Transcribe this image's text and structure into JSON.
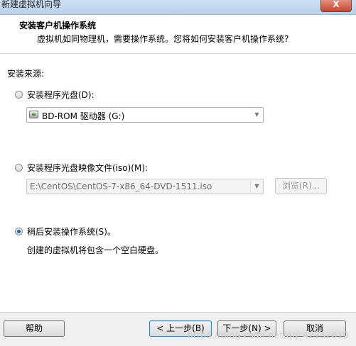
{
  "window": {
    "title": "新建虚拟机向导",
    "close_label": "X"
  },
  "header": {
    "title": "安装客户机操作系统",
    "subtitle": "虚拟机如同物理机，需要操作系统。您将如何安装客户机操作系统?"
  },
  "content": {
    "source_label": "安装来源:",
    "option_disc": {
      "label": "安装程序光盘(D):",
      "selected": false,
      "drive_value": "BD-ROM 驱动器 (G:)"
    },
    "option_iso": {
      "label": "安装程序光盘映像文件(iso)(M):",
      "selected": false,
      "path_value": "E:\\CentOS\\CentOS-7-x86_64-DVD-1511.iso",
      "browse_label": "浏览(R)..."
    },
    "option_later": {
      "label": "稍后安装操作系统(S)。",
      "selected": true,
      "description": "创建的虚拟机将包含一个空白硬盘。"
    }
  },
  "footer": {
    "help_label": "帮助",
    "back_label": "< 上一步(B)",
    "next_label": "下一步(N) >",
    "cancel_label": "取消"
  },
  "watermark": "https://blog.csdn.net/qq_42132019"
}
